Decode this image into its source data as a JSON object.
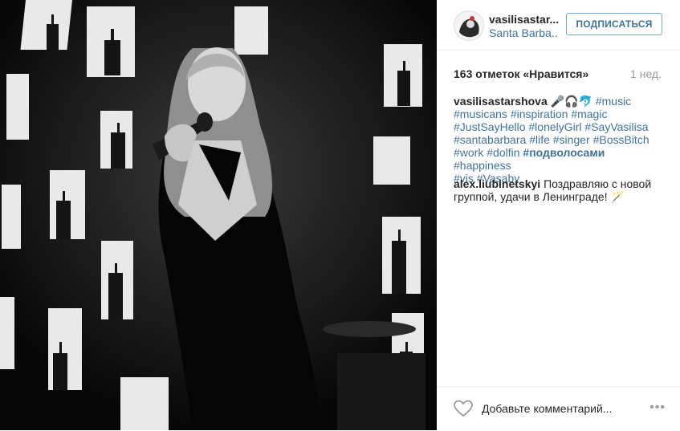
{
  "post": {
    "username": "vasilisastar...",
    "location": "Santa Barba..",
    "follow_label": "ПОДПИСАТЬСЯ",
    "likes_text": "163 отметок «Нравится»",
    "time_ago": "1 нед.",
    "caption": {
      "author": "vasilisastarshova",
      "emoji": "🎤🎧🐬",
      "lines": [
        [
          "#music"
        ],
        [
          "#musicans",
          "#inspiration",
          "#magic"
        ],
        [
          "#JustSayHello",
          "#lonelyGirl",
          "#SayVasilisa"
        ],
        [
          "#santabarbara",
          "#life",
          "#singer",
          "#BossBitch"
        ],
        [
          "#work",
          "#dolfin",
          "#подволосами",
          "#happiness"
        ],
        [
          "#vis",
          "#Vasaby"
        ]
      ]
    },
    "comment": {
      "author": "alex.liubinetskyi",
      "text": "Поздравляю с новой группой, удачи в Ленинграде! 🪄"
    },
    "add_comment_placeholder": "Добавьте комментарий...",
    "more_label": "•••",
    "icons": [
      "heart-icon",
      "more-options-icon"
    ]
  }
}
